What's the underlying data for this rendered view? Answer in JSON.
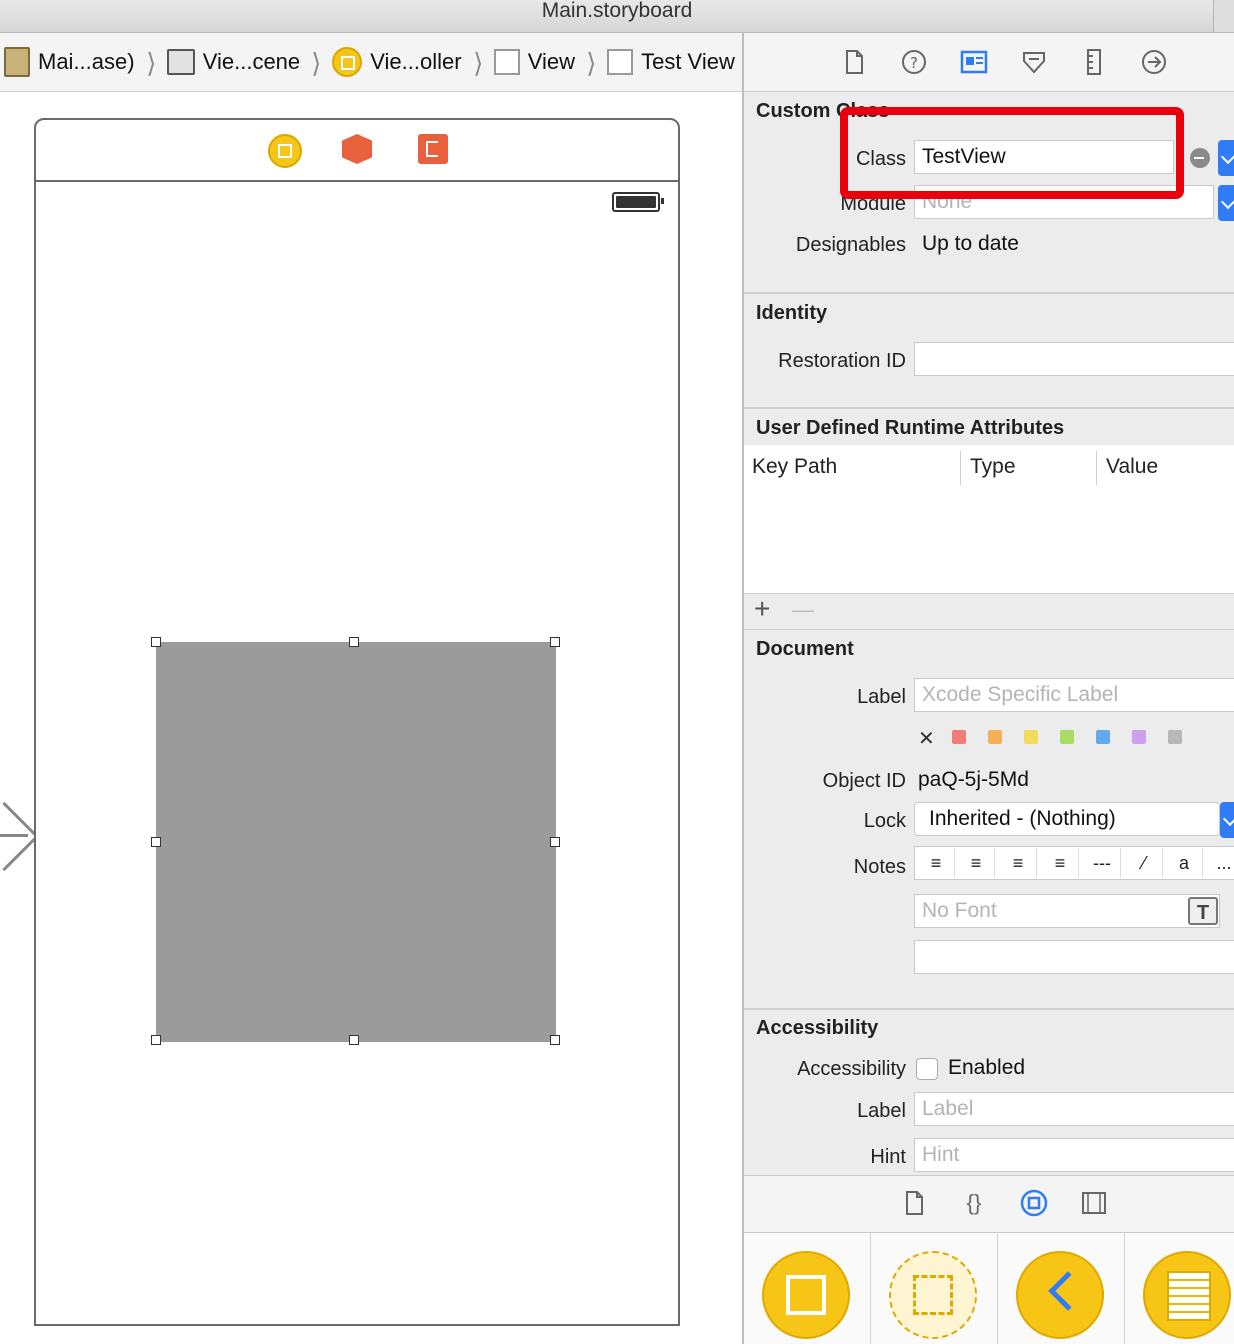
{
  "window": {
    "title": "Main.storyboard"
  },
  "breadcrumb": [
    {
      "label": "Mai...ase)",
      "icon": "storyboard-icon"
    },
    {
      "label": "Vie...cene",
      "icon": "scene-icon"
    },
    {
      "label": "Vie...oller",
      "icon": "view-controller-icon"
    },
    {
      "label": "View",
      "icon": "view-icon"
    },
    {
      "label": "Test View",
      "icon": "view-icon"
    }
  ],
  "inspector": {
    "tabs": [
      "file-inspector-icon",
      "quick-help-icon",
      "identity-inspector-icon",
      "attributes-inspector-icon",
      "size-inspector-icon",
      "connections-inspector-icon"
    ],
    "custom_class": {
      "title": "Custom Class",
      "class_label": "Class",
      "class_value": "TestView",
      "module_label": "Module",
      "module_placeholder": "None",
      "designables_label": "Designables",
      "designables_value": "Up to date"
    },
    "identity": {
      "title": "Identity",
      "restoration_label": "Restoration ID",
      "restoration_value": ""
    },
    "runtime_attrs": {
      "title": "User Defined Runtime Attributes",
      "columns": [
        "Key Path",
        "Type",
        "Value"
      ],
      "add": "+",
      "remove": "—"
    },
    "document": {
      "title": "Document",
      "label_label": "Label",
      "label_placeholder": "Xcode Specific Label",
      "clear": "✕",
      "swatches": [
        "#f07c7c",
        "#f5b05c",
        "#f2dc5e",
        "#a8dc62",
        "#62a9f0",
        "#cf9ff0",
        "#b8b8b8"
      ],
      "object_id_label": "Object ID",
      "object_id_value": "paQ-5j-5Md",
      "lock_label": "Lock",
      "lock_value": "Inherited - (Nothing)",
      "notes_label": "Notes",
      "notes_buttons": [
        "≡",
        "≡",
        "≡",
        "≡",
        "---",
        "⁄",
        "a",
        "..."
      ],
      "font_placeholder": "No Font",
      "font_button": "T"
    },
    "accessibility": {
      "title": "Accessibility",
      "acc_label": "Accessibility",
      "enabled_label": "Enabled",
      "enabled": false,
      "label_label": "Label",
      "label_placeholder": "Label",
      "hint_label": "Hint",
      "hint_placeholder": "Hint"
    },
    "library_tabs": [
      "file-template-icon",
      "code-snippet-icon",
      "object-library-icon",
      "media-library-icon"
    ],
    "library_items": [
      "view-controller-object-icon",
      "storyboard-reference-icon",
      "navigation-controller-icon",
      "table-view-controller-icon"
    ]
  }
}
